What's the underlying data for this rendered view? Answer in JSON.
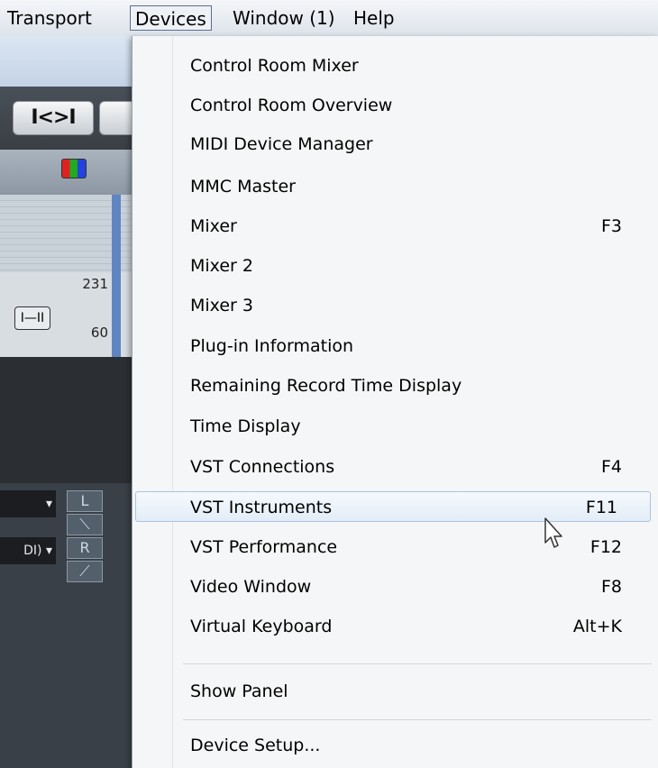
{
  "menubar": {
    "items": [
      {
        "label": "Transport"
      },
      {
        "label": "Devices"
      },
      {
        "label": "Window (1)"
      },
      {
        "label": "Help"
      }
    ]
  },
  "background_app": {
    "transport_glyph": "I<>I",
    "number_top": "231",
    "number_bottom": "60",
    "fader_glyph": "I—II",
    "select_1": "▾",
    "select_2": "DI) ▾",
    "eq_buttons": [
      "L",
      "⟍",
      "R",
      "⟋"
    ]
  },
  "menu": {
    "items": [
      {
        "label": "Control Room Mixer",
        "shortcut": ""
      },
      {
        "label": "Control Room Overview",
        "shortcut": ""
      },
      {
        "label": "MIDI Device Manager",
        "shortcut": ""
      },
      {
        "label": "MMC Master",
        "shortcut": ""
      },
      {
        "label": "Mixer",
        "shortcut": "F3"
      },
      {
        "label": "Mixer 2",
        "shortcut": ""
      },
      {
        "label": "Mixer 3",
        "shortcut": ""
      },
      {
        "label": "Plug-in Information",
        "shortcut": ""
      },
      {
        "label": "Remaining Record Time Display",
        "shortcut": ""
      },
      {
        "label": "Time Display",
        "shortcut": ""
      },
      {
        "label": "VST Connections",
        "shortcut": "F4"
      },
      {
        "label": "VST Instruments",
        "shortcut": "F11"
      },
      {
        "label": "VST Performance",
        "shortcut": "F12"
      },
      {
        "label": "Video Window",
        "shortcut": "F8"
      },
      {
        "label": "Virtual Keyboard",
        "shortcut": "Alt+K"
      }
    ],
    "show_panel": "Show Panel",
    "device_setup": "Device Setup...",
    "highlighted": "VST Instruments"
  },
  "colors": {
    "menu_bg": "#f5f6f7",
    "highlight_border": "#a9c3df",
    "menubar_active_border": "#5b6f8a"
  }
}
